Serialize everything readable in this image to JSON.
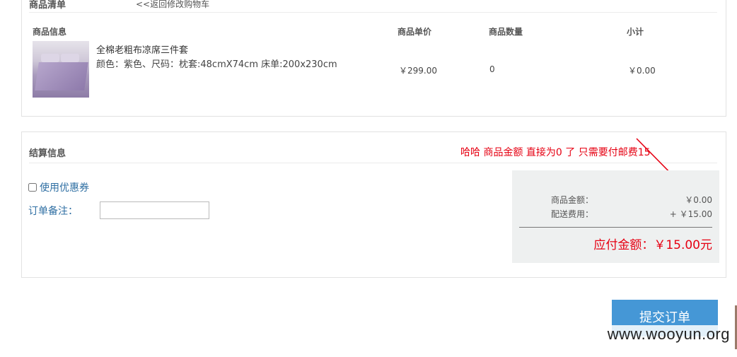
{
  "goods": {
    "section_title": "商品清单",
    "back_link": "<<返回修改购物车",
    "columns": [
      "商品信息",
      "商品单价",
      "商品数量",
      "小计"
    ],
    "items": [
      {
        "name": "全棉老粗布凉席三件套",
        "spec": "颜色：紫色、尺码：枕套:48cmX74cm 床单:200x230cm",
        "price": "￥299.00",
        "quantity": "0",
        "subtotal": "￥0.00"
      }
    ]
  },
  "settlement": {
    "section_title": "结算信息",
    "coupon_label": "使用优惠券",
    "remark_label": "订单备注：",
    "remark_value": "",
    "summary": {
      "goods_amount_label": "商品金额：",
      "goods_amount_value": "￥0.00",
      "shipping_label": "配送费用：",
      "shipping_value": "+ ￥15.00",
      "payable_text": "应付金额：￥15.00元"
    }
  },
  "annotation": {
    "text": "哈哈 商品金额 直接为0 了  只需要付邮费15",
    "color": "#e60012"
  },
  "submit_label": "提交订单",
  "watermark": "www.wooyun.org",
  "colors": {
    "accent_blue": "#4597d6",
    "link_blue": "#2f6fa3",
    "alert_red": "#e60012"
  }
}
